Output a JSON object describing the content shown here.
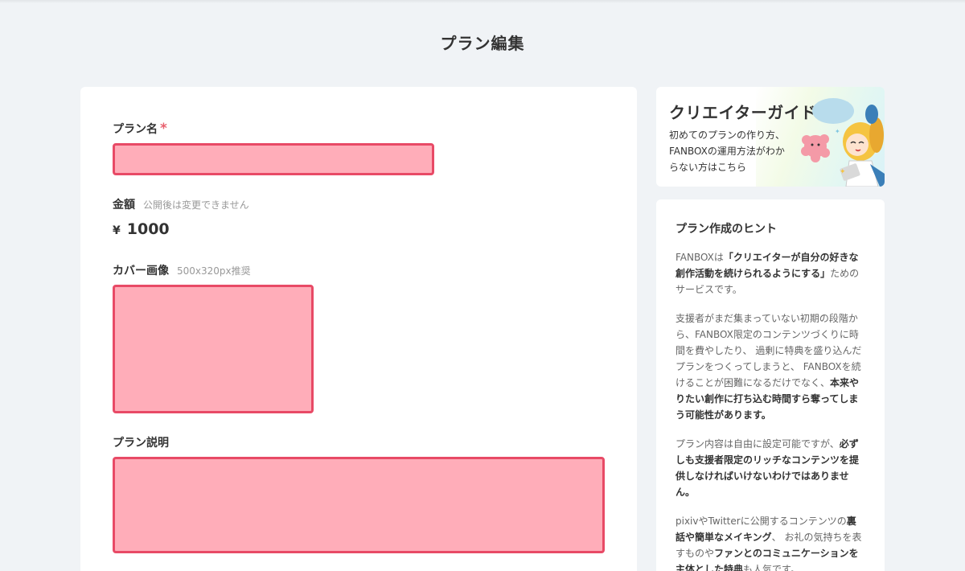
{
  "page": {
    "title": "プラン編集"
  },
  "form": {
    "plan_name": {
      "label": "プラン名",
      "required_mark": "*",
      "value": ""
    },
    "price": {
      "label": "金額",
      "note": "公開後は変更できません",
      "currency": "¥",
      "amount": "1000"
    },
    "cover_image": {
      "label": "カバー画像",
      "note": "500x320px推奨"
    },
    "description": {
      "label": "プラン説明",
      "value": ""
    },
    "error_color": "#e84a66",
    "error_fill": "#ffadb9"
  },
  "guide": {
    "title": "クリエイターガイド",
    "text": "初めてのプランの作り方、FANBOXの運用方法がわからない方はこちら",
    "illustration": "mascot-character-illustration"
  },
  "hints": {
    "title": "プラン作成のヒント",
    "p1": {
      "a": "FANBOXは",
      "b": "「クリエイターが自分の好きな創作活動を続けられるようにする」",
      "c": "ためのサービスです。"
    },
    "p2": {
      "a": "支援者がまだ集まっていない初期の段階から、FANBOX限定のコンテンツづくりに時間を費やしたり、 過剰に特典を盛り込んだプランをつくってしまうと、 FANBOXを続けることが困難になるだけでなく、",
      "b": "本来やりたい創作に打ち込む時間すら奪ってしまう可能性があります。"
    },
    "p3": {
      "a": "プラン内容は自由に設定可能ですが、",
      "b": "必ずしも支援者限定のリッチなコンテンツを提供しなければいけないわけではありません。"
    },
    "p4": {
      "a": "pixivやTwitterに公開するコンテンツの",
      "b": "裏話や簡単なメイキング",
      "c": "、 お礼の気持ちを表すものや",
      "d": "ファンとのコミュニケーションを主体とした特典",
      "e": "も人気です。"
    }
  }
}
